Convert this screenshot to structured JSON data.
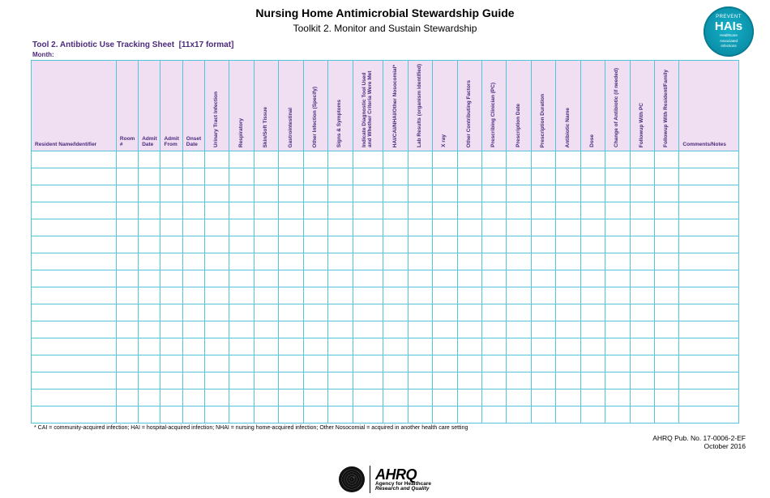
{
  "header": {
    "main_title": "Nursing Home Antimicrobial Stewardship Guide",
    "sub_title": "Toolkit 2. Monitor and Sustain Stewardship",
    "tool_label": "Tool 2. Antibiotic Use Tracking Sheet",
    "tool_format": "[11x17 format]",
    "month_label": "Month:"
  },
  "badge": {
    "prevent": "PREVENT",
    "hais": "HAIs",
    "line1": "Healthcare",
    "line2": "Associated",
    "line3": "Infections"
  },
  "columns": [
    "Resident Name/Identifier",
    "Room #",
    "Admit Date",
    "Admit From",
    "Onset Date",
    "Urinary Tract Infection",
    "Respiratory",
    "Skin/Soft Tissue",
    "Gastrointestinal",
    "Other Infection (Specify)",
    "Signs & Symptoms",
    "Indicate Diagnostic Tool Used and Whether Criteria Were Met",
    "HAI/CAI/NHAI/Other Nosocomial*",
    "Lab Results (organism identified)",
    "X ray",
    "Other Contributing Factors",
    "Prescribing Clinician (PC)",
    "Prescription Date",
    "Prescription Duration",
    "Antibiotic Name",
    "Dose",
    "Change of Antibiotic (if needed)",
    "Followup With PC",
    "Followup With Resident/Family",
    "Comments/Notes"
  ],
  "num_rows": 16,
  "footnote": "* CAI = community-acquired infection; HAI = hospital-acquired infection; NHAI = nursing home-acquired infection; Other Nosocomial = acquired in another health care setting",
  "publication": {
    "pub_no": "AHRQ Pub. No. 17-0006-2-EF",
    "date": "October 2016"
  },
  "logo": {
    "ahrq": "AHRQ",
    "agency1": "Agency for Healthcare",
    "agency2": "Research and Quality"
  }
}
